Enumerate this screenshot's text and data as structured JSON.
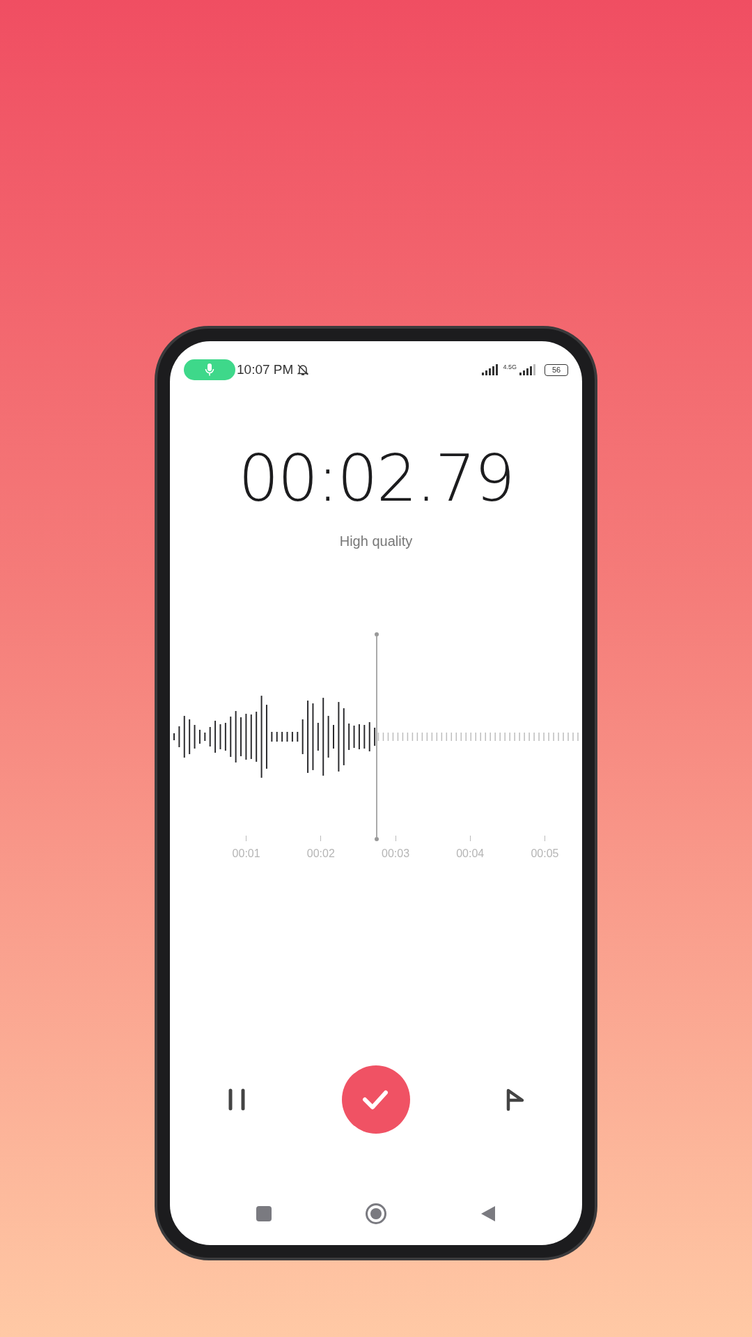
{
  "status_bar": {
    "time": "10:07 PM",
    "network": "4.5G",
    "battery": "56"
  },
  "recorder": {
    "timer": "00:02.79",
    "quality": "High quality"
  },
  "timeline": [
    "00:01",
    "00:02",
    "00:03",
    "00:04",
    "00:05"
  ]
}
